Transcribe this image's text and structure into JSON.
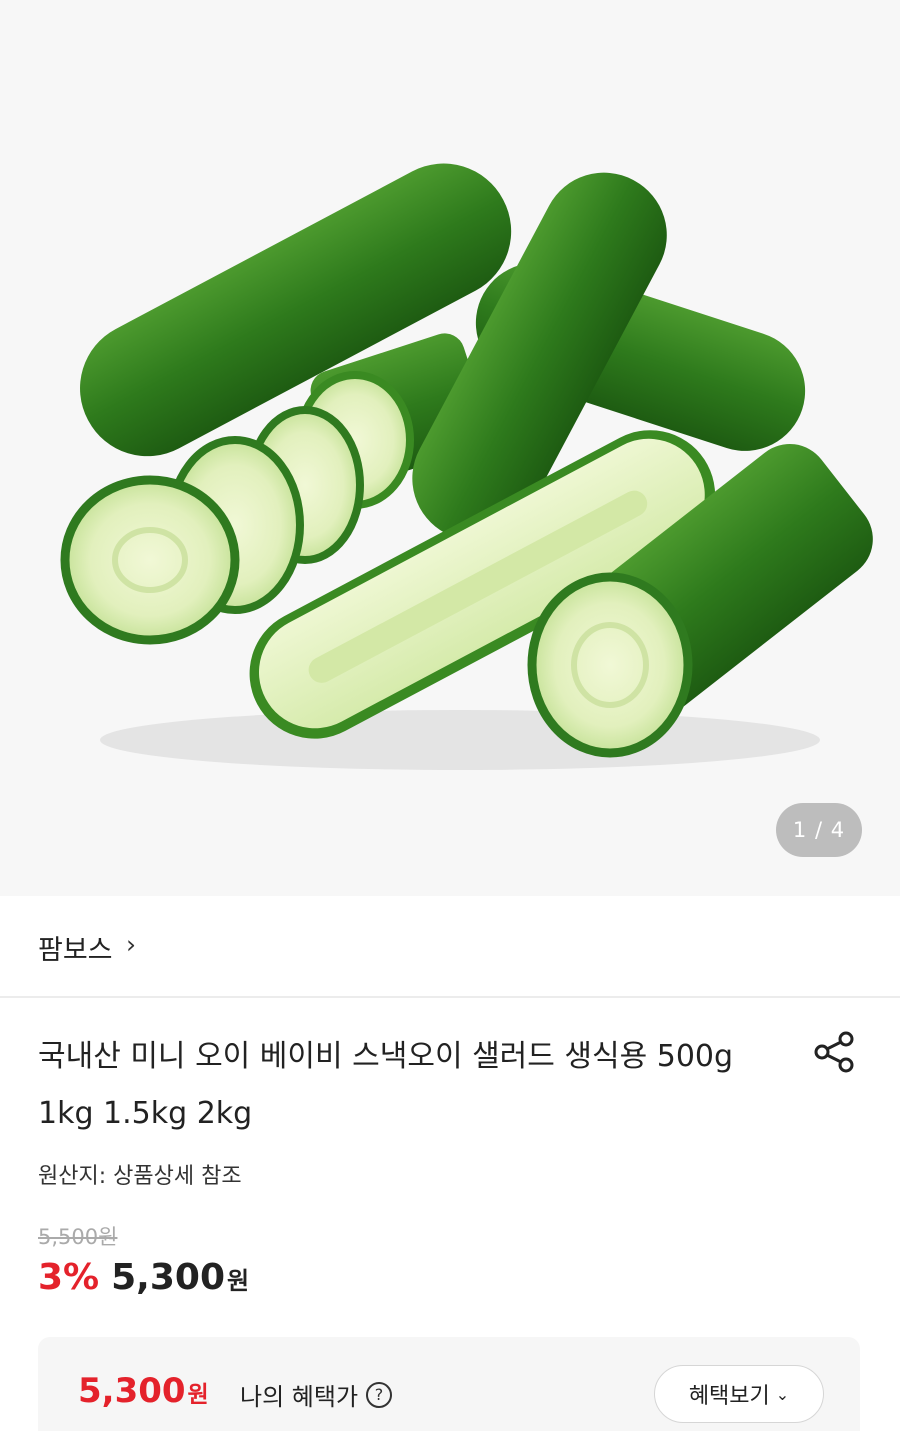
{
  "image_counter": "1 / 4",
  "store": {
    "name": "팜보스",
    "chevron": "›"
  },
  "product": {
    "title": "국내산 미니 오이 베이비 스낵오이 샐러드 생식용 500g 1kg 1.5kg 2kg",
    "origin": "원산지: 상품상세 참조"
  },
  "pricing": {
    "original": "5,500원",
    "discount": "3%",
    "price": "5,300",
    "won": "원"
  },
  "benefit": {
    "price": "5,300",
    "won": "원",
    "label": "나의 혜택가",
    "help": "?",
    "button": "혜택보기",
    "button_chevron": "⌄"
  },
  "icons": {
    "share": "share-icon",
    "help": "help-circle-icon",
    "chevron": "chevron-right-icon"
  },
  "colors": {
    "accent_red": "#e4222b",
    "cucumber_dark": "#2f7a1f",
    "cucumber_flesh": "#e6f2c8"
  }
}
